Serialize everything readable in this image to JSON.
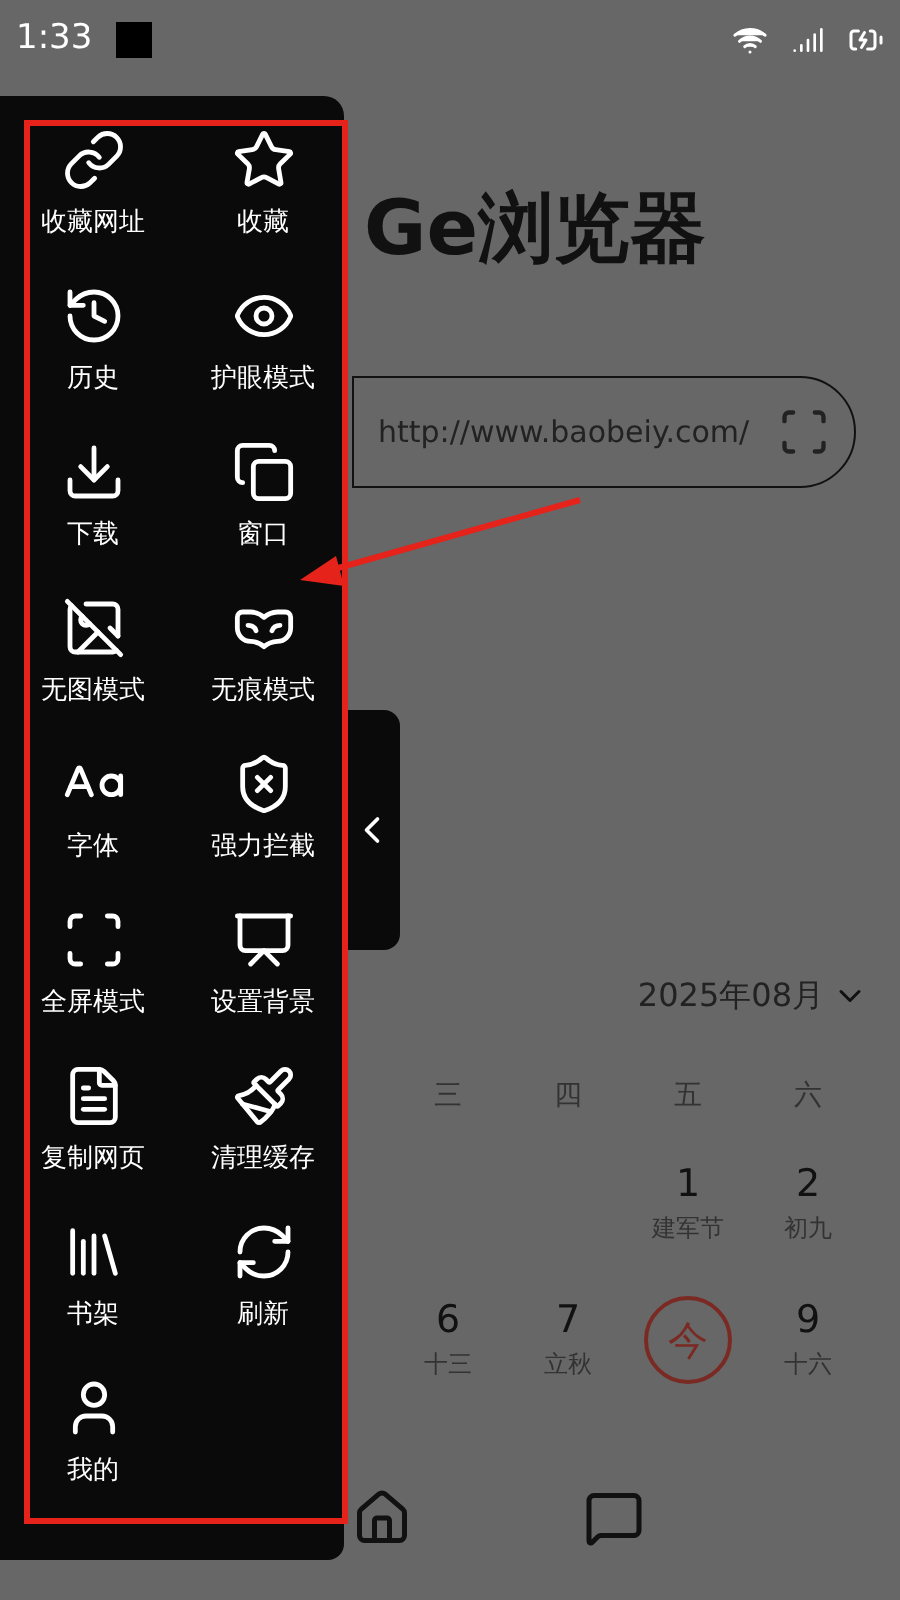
{
  "status_bar": {
    "time": "1:33"
  },
  "title": "Ge浏览器",
  "url_field": {
    "value": "http://www.baobeiy.com/"
  },
  "calendar": {
    "month": "2025年08月",
    "weekdays": [
      "三",
      "四",
      "五",
      "六"
    ],
    "weeks": [
      {
        "cells": [
          {
            "day": "1",
            "sub": "建军节",
            "today": false
          },
          {
            "day": "2",
            "sub": "初九",
            "today": false
          }
        ]
      },
      {
        "cells": [
          {
            "day": "6",
            "sub": "十三",
            "today": false
          },
          {
            "day": "7",
            "sub": "立秋",
            "today": false
          },
          {
            "day": "今",
            "today": true
          },
          {
            "day": "9",
            "sub": "十六",
            "today": false
          }
        ]
      }
    ]
  },
  "side_menu": {
    "items": [
      {
        "label": "收藏网址"
      },
      {
        "label": "收藏"
      },
      {
        "label": "历史"
      },
      {
        "label": "护眼模式"
      },
      {
        "label": "下载"
      },
      {
        "label": "窗口"
      },
      {
        "label": "无图模式"
      },
      {
        "label": "无痕模式"
      },
      {
        "label": "字体"
      },
      {
        "label": "强力拦截"
      },
      {
        "label": "全屏模式"
      },
      {
        "label": "设置背景"
      },
      {
        "label": "复制网页"
      },
      {
        "label": "清理缓存"
      },
      {
        "label": "书架"
      },
      {
        "label": "刷新"
      },
      {
        "label": "我的"
      }
    ]
  }
}
